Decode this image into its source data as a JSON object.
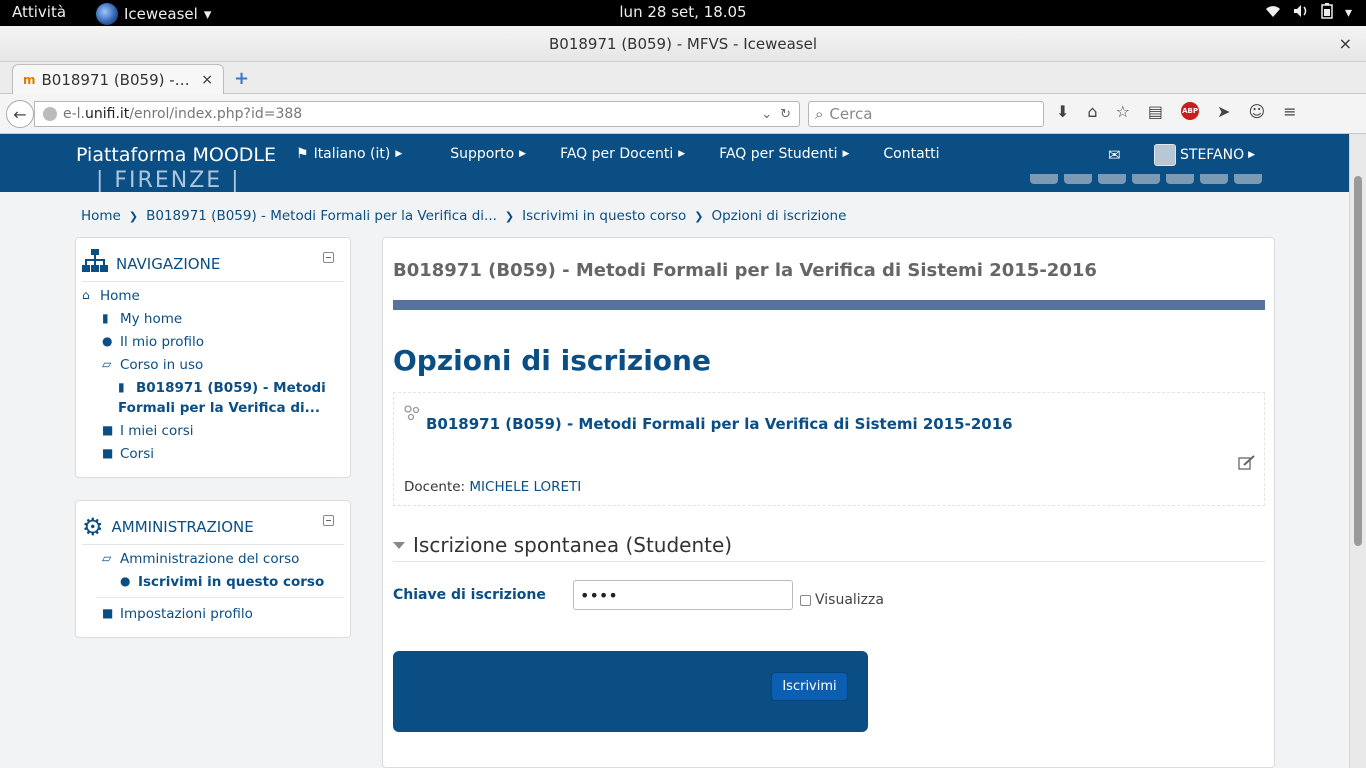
{
  "gnome": {
    "activities": "Attività",
    "app_name": "Iceweasel",
    "app_caret": "▾",
    "clock": "lun 28 set, 18.05"
  },
  "window": {
    "title": "B018971 (B059) - MFVS - Iceweasel",
    "close": "×"
  },
  "tab": {
    "label": "B018971 (B059) -…",
    "close": "×",
    "new": "+"
  },
  "urlbar": {
    "prefix": "e-l.",
    "domain": "unifi.it",
    "path": "/enrol/index.php?id=388"
  },
  "search": {
    "placeholder": "Cerca"
  },
  "moodle_nav": {
    "brand": "Piattaforma MOODLE",
    "menu": [
      {
        "label": "Italiano (it)",
        "icon": "flag-icon"
      },
      {
        "label": "Supporto"
      },
      {
        "label": "FAQ per Docenti"
      },
      {
        "label": "FAQ per Studenti"
      },
      {
        "label": "Contatti"
      }
    ],
    "user": "STEFANO",
    "logo_fragment": "| FIRENZE |"
  },
  "breadcrumb": [
    "Home",
    "B018971 (B059) - Metodi Formali per la Verifica di...",
    "Iscrivimi in questo corso",
    "Opzioni di iscrizione"
  ],
  "nav_block": {
    "title": "NAVIGAZIONE",
    "items": [
      {
        "label": "Home",
        "icon": "home-icon"
      },
      {
        "label": "My home",
        "icon": "file-icon"
      },
      {
        "label": "Il mio profilo",
        "icon": "user-icon"
      },
      {
        "label": "Corso in uso",
        "icon": "folder-open-icon"
      },
      {
        "label": "B018971 (B059) - Metodi",
        "icon": "file-icon"
      },
      {
        "label": "Formali per la Verifica di..."
      },
      {
        "label": "I miei corsi",
        "icon": "folder-icon"
      },
      {
        "label": "Corsi",
        "icon": "folder-icon"
      }
    ]
  },
  "admin_block": {
    "title": "AMMINISTRAZIONE",
    "items": [
      {
        "label": "Amministrazione del corso",
        "icon": "folder-open-icon"
      },
      {
        "label": "Iscrivimi in questo corso",
        "icon": "user-icon"
      },
      {
        "label": "Impostazioni profilo",
        "icon": "folder-icon"
      }
    ]
  },
  "main": {
    "course_title": "B018971 (B059) - Metodi Formali per la Verifica di Sistemi 2015-2016",
    "heading": "Opzioni di iscrizione",
    "coursebox": {
      "name": "B018971 (B059) - Metodi Formali per la Verifica di Sistemi 2015-2016",
      "teacher_label": "Docente: ",
      "teacher_name": "MICHELE LORETI"
    },
    "section_title": "Iscrizione spontanea (Studente)",
    "enrol_key_label": "Chiave di iscrizione",
    "enrol_key_value": "••••",
    "reveal_label": "Visualizza",
    "submit_label": "Iscrivimi"
  },
  "colors": {
    "brand": "#0a4e84",
    "title_bar": "#56739a",
    "button": "#0c5fb0"
  }
}
